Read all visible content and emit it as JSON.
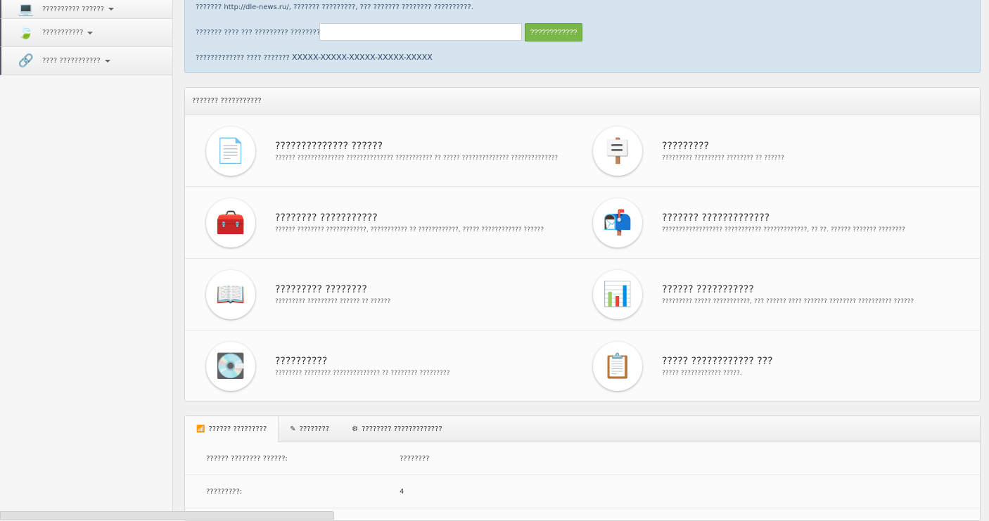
{
  "sidebar": {
    "items": [
      {
        "icon": "laptop-icon",
        "glyph": "💻",
        "label": "?????????? ??????"
      },
      {
        "icon": "leaf-icon",
        "glyph": "🍃",
        "label": "???????????"
      },
      {
        "icon": "link-icon",
        "glyph": "🔗",
        "label": "???? ???????????"
      }
    ]
  },
  "info": {
    "line1": "??????? http://dle-news.ru/, ??????? ?????????, ??? ??????? ???????? ??????????.",
    "key_label": "??????? ???? ??? ????????? ????????:",
    "key_value": "",
    "button": "????????????",
    "license_label": "????????????? ???? ???????",
    "license_key": "XXXXX-XXXXX-XXXXX-XXXXX-XXXXX"
  },
  "panel": {
    "title": "??????? ???????????",
    "items": [
      {
        "icon": "document-icon",
        "glyph": "📄",
        "title": "?????????????? ??????",
        "desc": "?????? ?????????????? ?????????????? ??????????? ?? ????? ?????????????? ??????????????"
      },
      {
        "icon": "billboard-icon",
        "glyph": "🪧",
        "title": "?????????",
        "desc": "????????? ????????? ???????? ?? ??????"
      },
      {
        "icon": "toolbox-icon",
        "glyph": "🧰",
        "title": "???????? ???????????",
        "desc": "?????? ???????? ????????????, ??????????? ?? ????????????, ????? ???????????? ??????"
      },
      {
        "icon": "mailbox-icon",
        "glyph": "📬",
        "title": "??????? ?????????????",
        "desc": "?????????????????? ??????????? ?????????????, ?? ??. ?????? ??????? ????????"
      },
      {
        "icon": "book-icon",
        "glyph": "📖",
        "title": "????????? ????????",
        "desc": "????????? ????????? ?????? ?? ??????"
      },
      {
        "icon": "chart-icon",
        "glyph": "📊",
        "title": "?????? ???????????",
        "desc": "????????? ????? ???????????, ??? ?????? ???? ??????? ???????? ?????????? ??????"
      },
      {
        "icon": "disk-icon",
        "glyph": "💽",
        "title": "??????????",
        "desc": "???????? ???????? ?????????????? ?? ???????? ?????????"
      },
      {
        "icon": "clipboard-icon",
        "glyph": "📋",
        "title": "????? ???????????? ???",
        "desc": "????? ???????????? ?????."
      }
    ]
  },
  "tabs": {
    "items": [
      {
        "icon": "stats-icon",
        "glyph": "📶",
        "label": "?????? ?????????"
      },
      {
        "icon": "edit-icon",
        "glyph": "✎",
        "label": "????????"
      },
      {
        "icon": "gear-icon",
        "glyph": "⚙",
        "label": "???????? ?????????????"
      }
    ],
    "rows": [
      {
        "key": "?????? ???????? ??????:",
        "value": "????????"
      },
      {
        "key": "?????????:",
        "value": "4"
      }
    ]
  }
}
